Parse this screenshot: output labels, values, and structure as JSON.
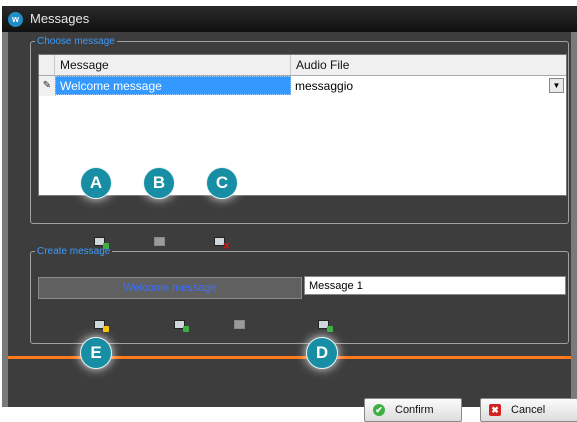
{
  "window": {
    "title": "Messages",
    "app_icon_glyph": "w"
  },
  "choose_group": {
    "legend": "Choose message",
    "columns": [
      "Message",
      "Audio File"
    ],
    "rows": [
      {
        "indicator": "✎",
        "message": "Welcome message",
        "audio_file": "messaggio"
      }
    ],
    "dropdown_glyph": "▼"
  },
  "create_group": {
    "legend": "Create message",
    "preview_text": "Welcome message",
    "name_input_value": "Message 1"
  },
  "markers": {
    "a": "A",
    "b": "B",
    "c": "C",
    "d": "D",
    "e": "E"
  },
  "buttons": {
    "confirm": "Confirm",
    "cancel": "Cancel",
    "confirm_icon": "✔",
    "cancel_icon": "✖"
  },
  "icons": {
    "grid_toolbar": [
      "add-message-icon",
      "edit-message-icon",
      "delete-message-icon"
    ],
    "create_toolbar": [
      "record-message-icon",
      "add-audio-icon",
      "copy-icon",
      "save-message-icon"
    ]
  },
  "colors": {
    "accent_orange": "#ff7a1a",
    "marker_teal": "#178ea3",
    "selection_blue": "#3399ff",
    "legend_blue": "#3b9bff"
  }
}
